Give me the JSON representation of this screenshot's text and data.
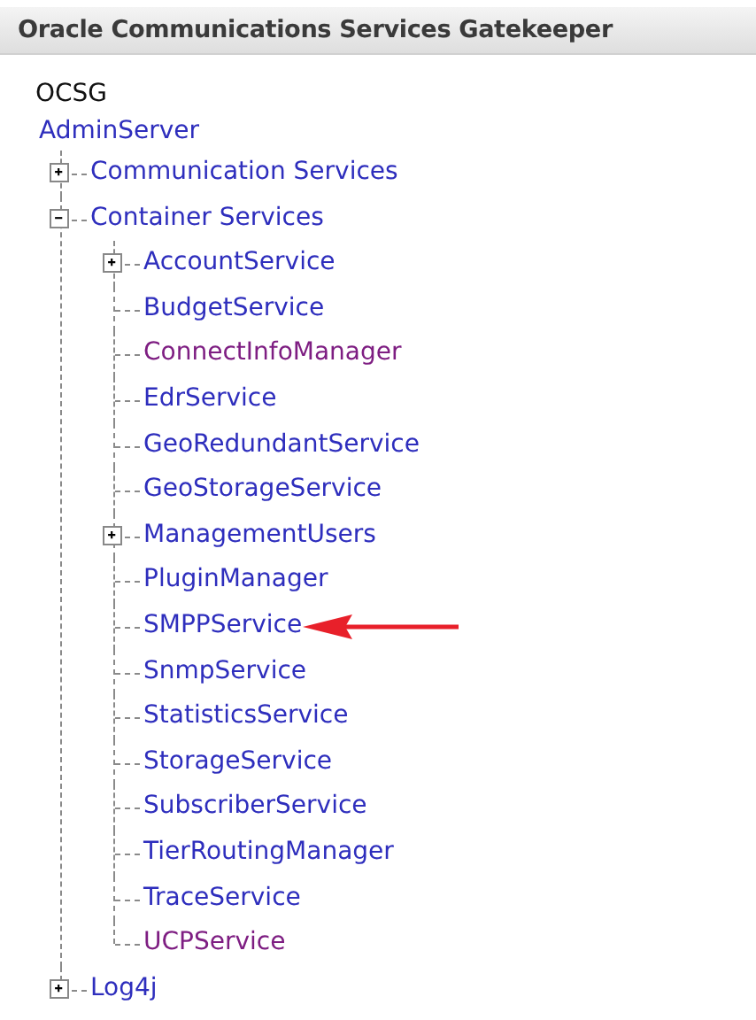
{
  "header": {
    "title": "Oracle Communications Services Gatekeeper"
  },
  "tree": {
    "root_label": "OCSG",
    "nodes": [
      {
        "label": "AdminServer",
        "visited": false,
        "arrow": false,
        "children": [
          {
            "label": "Communication Services",
            "expanded": false,
            "visited": false,
            "arrow": false
          },
          {
            "label": "Container Services",
            "expanded": true,
            "visited": false,
            "arrow": false,
            "children": [
              {
                "label": "AccountService",
                "expanded": false,
                "visited": false,
                "arrow": false
              },
              {
                "label": "BudgetService",
                "visited": false,
                "arrow": false
              },
              {
                "label": "ConnectInfoManager",
                "visited": true,
                "arrow": false
              },
              {
                "label": "EdrService",
                "visited": false,
                "arrow": false
              },
              {
                "label": "GeoRedundantService",
                "visited": false,
                "arrow": false
              },
              {
                "label": "GeoStorageService",
                "visited": false,
                "arrow": false
              },
              {
                "label": "ManagementUsers",
                "expanded": false,
                "visited": false,
                "arrow": false
              },
              {
                "label": "PluginManager",
                "visited": false,
                "arrow": false
              },
              {
                "label": "SMPPService",
                "visited": false,
                "arrow": true
              },
              {
                "label": "SnmpService",
                "visited": false,
                "arrow": false
              },
              {
                "label": "StatisticsService",
                "visited": false,
                "arrow": false
              },
              {
                "label": "StorageService",
                "visited": false,
                "arrow": false
              },
              {
                "label": "SubscriberService",
                "visited": false,
                "arrow": false
              },
              {
                "label": "TierRoutingManager",
                "visited": false,
                "arrow": false
              },
              {
                "label": "TraceService",
                "visited": false,
                "arrow": false
              },
              {
                "label": "UCPService",
                "visited": true,
                "arrow": false
              }
            ]
          },
          {
            "label": "Log4j",
            "expanded": false,
            "visited": false,
            "arrow": false
          }
        ]
      }
    ]
  }
}
